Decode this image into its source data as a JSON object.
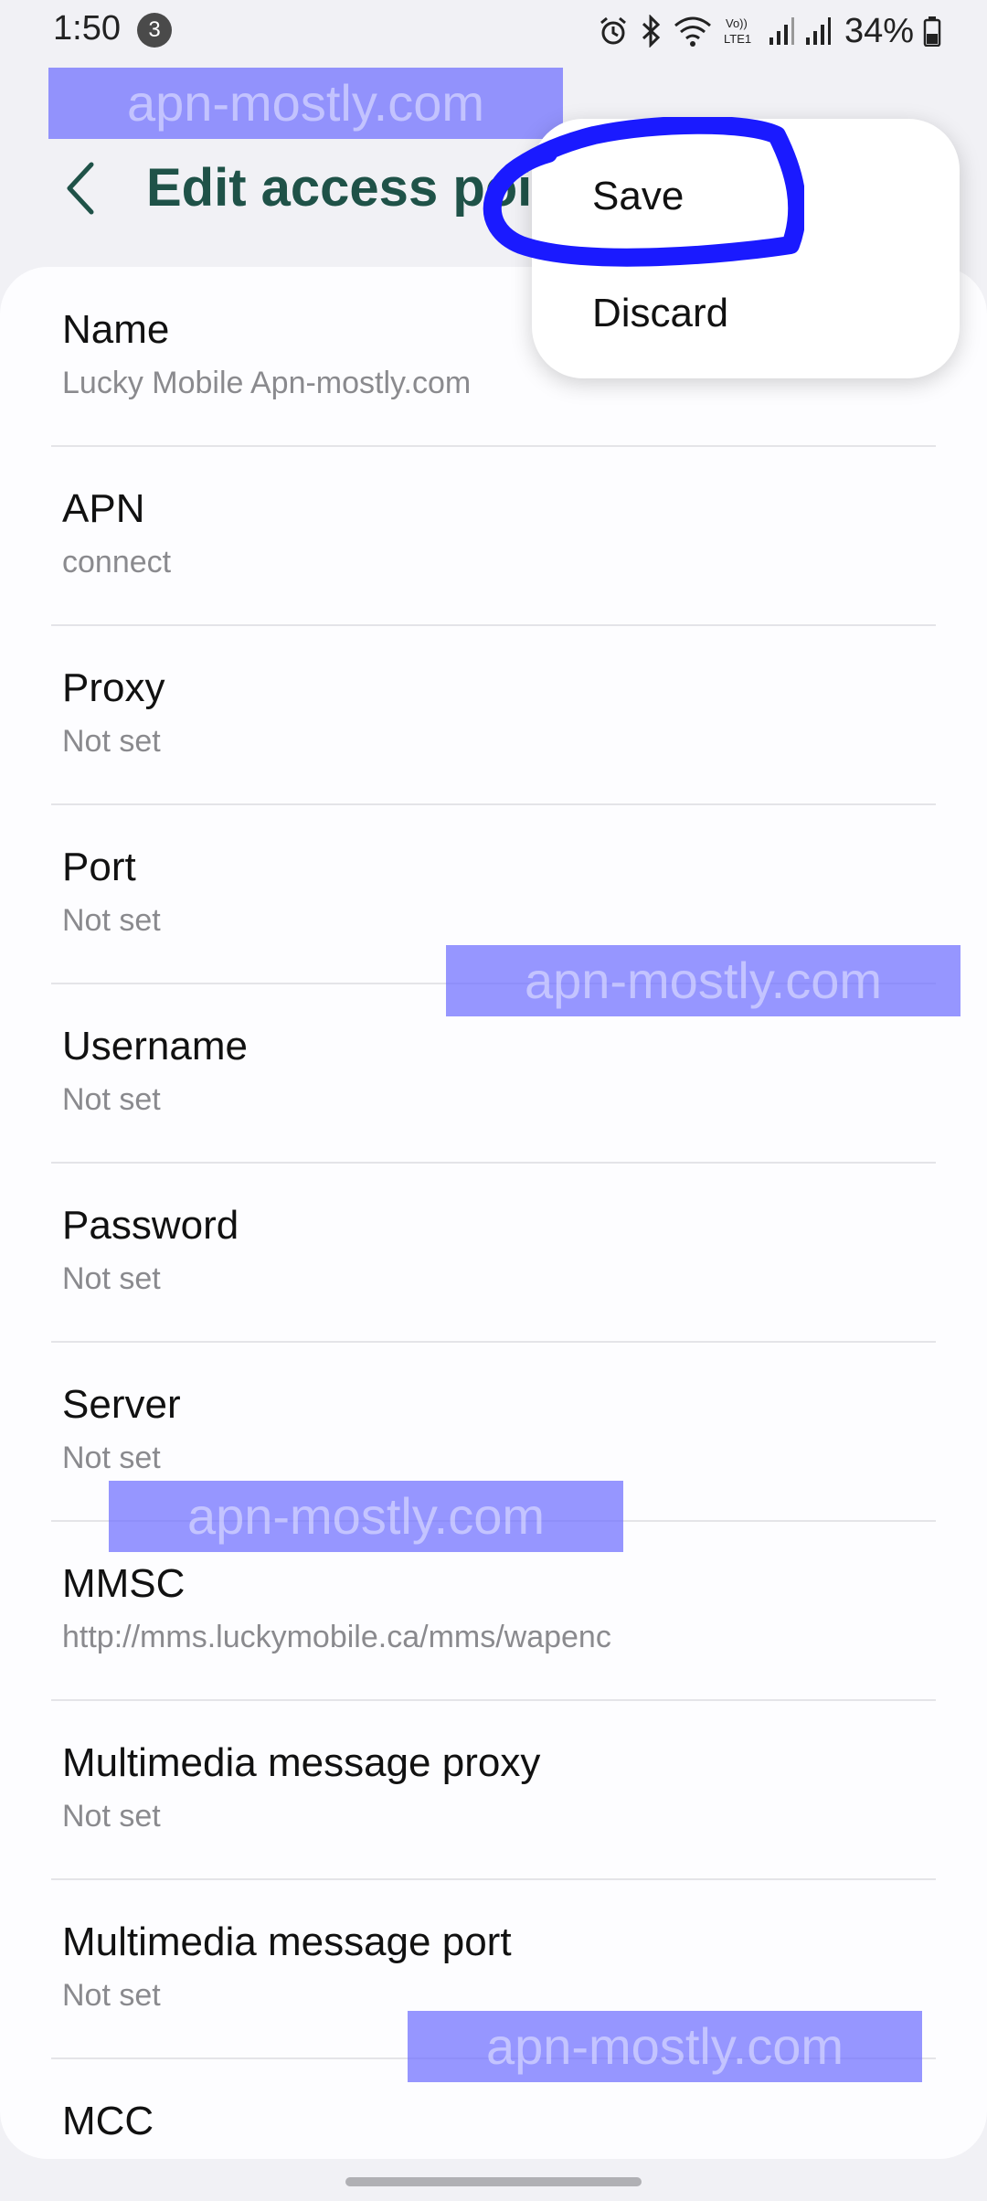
{
  "status_bar": {
    "time": "1:50",
    "notification_count": "3",
    "battery": "34%",
    "icons": [
      "alarm-icon",
      "bluetooth-icon",
      "wifi-icon",
      "volte-icon",
      "signal-icon",
      "signal-icon",
      "battery-icon"
    ]
  },
  "header": {
    "title": "Edit access point"
  },
  "watermark": {
    "text": "apn-mostly.com",
    "color": "#6e6eff"
  },
  "popup": {
    "items": [
      {
        "label": "Save"
      },
      {
        "label": "Discard"
      }
    ]
  },
  "settings": {
    "rows": [
      {
        "label": "Name",
        "value": "Lucky Mobile Apn-mostly.com"
      },
      {
        "label": "APN",
        "value": "connect"
      },
      {
        "label": "Proxy",
        "value": "Not set"
      },
      {
        "label": "Port",
        "value": "Not set"
      },
      {
        "label": "Username",
        "value": "Not set"
      },
      {
        "label": "Password",
        "value": "Not set"
      },
      {
        "label": "Server",
        "value": "Not set"
      },
      {
        "label": "MMSC",
        "value": "http://mms.luckymobile.ca/mms/wapenc"
      },
      {
        "label": "Multimedia message proxy",
        "value": "Not set"
      },
      {
        "label": "Multimedia message port",
        "value": "Not set"
      },
      {
        "label": "MCC",
        "value": ""
      }
    ]
  },
  "colors": {
    "title": "#1f5248",
    "background": "#f1f1f5",
    "card": "#fdfdff",
    "annotation": "#1a1aff"
  }
}
